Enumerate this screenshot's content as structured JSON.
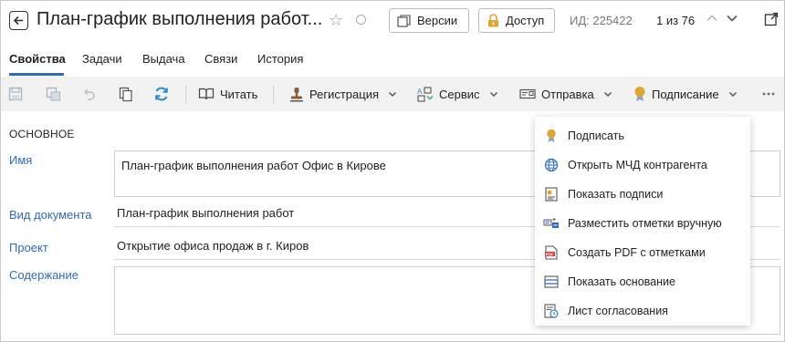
{
  "header": {
    "title": "План-график выполнения работ...",
    "versions_label": "Версии",
    "access_label": "Доступ",
    "doc_id": "ИД: 225422",
    "pager": "1 из 76"
  },
  "tabs": [
    {
      "label": "Свойства",
      "active": true
    },
    {
      "label": "Задачи"
    },
    {
      "label": "Выдача"
    },
    {
      "label": "Связи"
    },
    {
      "label": "История"
    }
  ],
  "toolbar": {
    "read_label": "Читать",
    "registration_label": "Регистрация",
    "service_label": "Сервис",
    "send_label": "Отправка",
    "signing_label": "Подписание",
    "more_icon": "more-horizontal-icon"
  },
  "form": {
    "section_title": "ОСНОВНОЕ",
    "name_label": "Имя",
    "name_value": "План-график выполнения работ Офис в Кирове",
    "doc_type_label": "Вид документа",
    "doc_type_value": "План-график выполнения работ",
    "project_label": "Проект",
    "project_value": "Открытие офиса продаж в г. Киров",
    "content_label": "Содержание",
    "content_value": ""
  },
  "signing_menu": {
    "items": [
      {
        "label": "Подписать",
        "icon": "medal-icon"
      },
      {
        "label": "Открыть МЧД контрагента",
        "icon": "globe-icon"
      },
      {
        "label": "Показать подписи",
        "icon": "certificate-icon"
      },
      {
        "label": "Разместить отметки вручную",
        "icon": "stamp-place-icon"
      },
      {
        "label": "Создать PDF с отметками",
        "icon": "pdf-icon"
      },
      {
        "label": "Показать основание",
        "icon": "list-icon"
      },
      {
        "label": "Лист согласования",
        "icon": "approval-sheet-icon"
      }
    ]
  },
  "colors": {
    "accent": "#2e6bb8",
    "toolbar_bg": "#f2f2f2",
    "medal": "#e0a530",
    "refresh": "#2e8bd0"
  }
}
